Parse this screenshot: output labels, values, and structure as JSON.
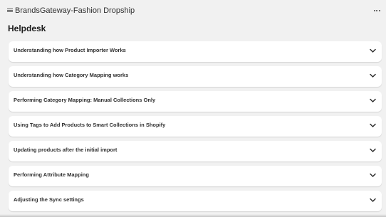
{
  "app": {
    "title": "BrandsGateway-Fashion Dropship",
    "logo_icon": "app-logo-icon",
    "more_icon": "more-horizontal-icon"
  },
  "page": {
    "title": "Helpdesk"
  },
  "faq": {
    "expand_icon": "chevron-down-icon",
    "items": [
      {
        "label": "Understanding how Product Importer Works"
      },
      {
        "label": "Understanding how Category Mapping works"
      },
      {
        "label": "Performing Category Mapping: Manual Collections Only"
      },
      {
        "label": "Using Tags to Add Products to Smart Collections in Shopify"
      },
      {
        "label": "Updating products after the initial import"
      },
      {
        "label": "Performing Attribute Mapping"
      },
      {
        "label": "Adjusting the Sync settings"
      }
    ]
  }
}
